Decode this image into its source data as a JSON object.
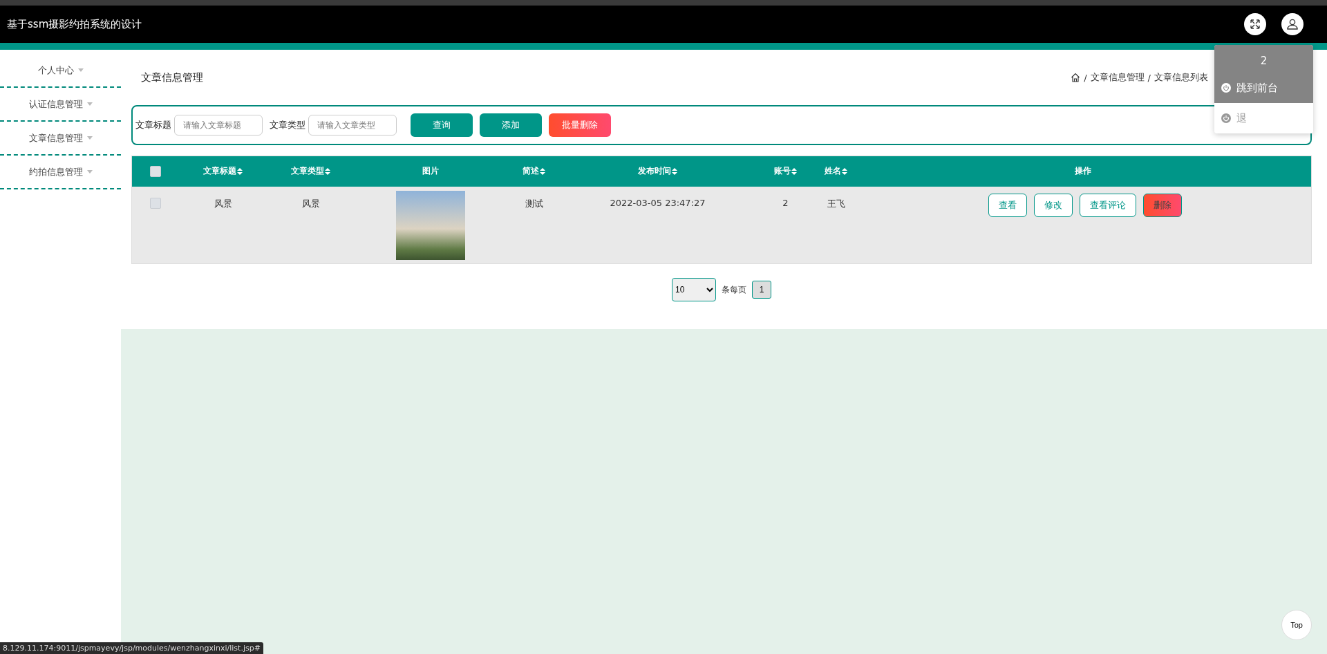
{
  "header": {
    "title": "基于ssm摄影约拍系统的设计"
  },
  "user_menu": {
    "username": "2",
    "items": [
      {
        "label": "跳到前台",
        "highlighted": true
      },
      {
        "label": "退",
        "highlighted": false
      }
    ]
  },
  "sidebar": {
    "items": [
      {
        "label": "个人中心"
      },
      {
        "label": "认证信息管理"
      },
      {
        "label": "文章信息管理"
      },
      {
        "label": "约拍信息管理"
      }
    ]
  },
  "page": {
    "heading": "文章信息管理",
    "separator": "/",
    "breadcrumb": [
      "文章信息管理",
      "文章信息列表"
    ]
  },
  "search": {
    "fields": [
      {
        "label": "文章标题",
        "placeholder": "请输入文章标题"
      },
      {
        "label": "文章类型",
        "placeholder": "请输入文章类型"
      }
    ],
    "buttons": [
      {
        "label": "查询",
        "kind": "primary"
      },
      {
        "label": "添加",
        "kind": "primary"
      },
      {
        "label": "批量删除",
        "kind": "danger"
      }
    ]
  },
  "table": {
    "select_all_checked": false,
    "columns": [
      {
        "label": "文章标题",
        "sortable": true
      },
      {
        "label": "文章类型",
        "sortable": true
      },
      {
        "label": "图片",
        "sortable": false
      },
      {
        "label": "简述",
        "sortable": true
      },
      {
        "label": "发布时间",
        "sortable": true
      },
      {
        "label": "账号",
        "sortable": true
      },
      {
        "label": "姓名",
        "sortable": true
      },
      {
        "label": "操作",
        "sortable": false
      }
    ],
    "rows": [
      {
        "checked": false,
        "cells": [
          "风景",
          "风景",
          null,
          "测试",
          "2022-03-05 23:47:27",
          "2",
          "王飞"
        ],
        "actions": [
          {
            "label": "查看",
            "kind": "outline"
          },
          {
            "label": "修改",
            "kind": "outline"
          },
          {
            "label": "查看评论",
            "kind": "outline"
          },
          {
            "label": "删除",
            "kind": "danger"
          }
        ]
      }
    ]
  },
  "pagination": {
    "page_size": "10",
    "per_page_label": "条每页",
    "pages": [
      {
        "label": "1",
        "selected": true
      }
    ]
  },
  "back_to_top": "Top",
  "status_url": "8.129.11.174:9011/jspmayevy/jsp/modules/wenzhangxinxi/list.jsp#"
}
